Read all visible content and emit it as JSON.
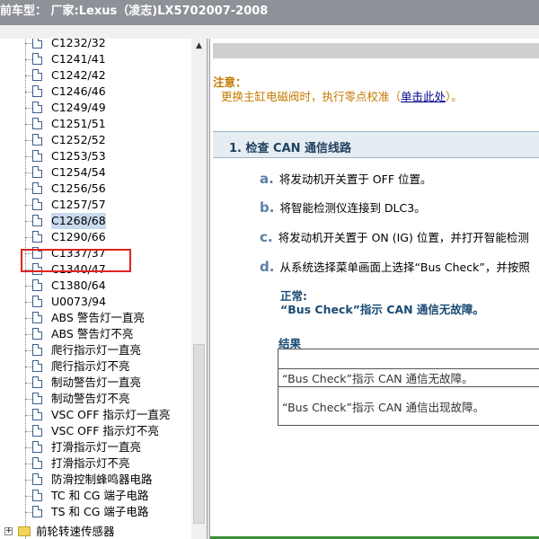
{
  "window": {
    "title": "前车型：  厂家:Lexus（凌志)LX5702007-2008"
  },
  "tree": {
    "items": [
      {
        "label": "C1232/32"
      },
      {
        "label": "C1241/41"
      },
      {
        "label": "C1242/42"
      },
      {
        "label": "C1246/46"
      },
      {
        "label": "C1249/49"
      },
      {
        "label": "C1251/51"
      },
      {
        "label": "C1252/52"
      },
      {
        "label": "C1253/53"
      },
      {
        "label": "C1254/54"
      },
      {
        "label": "C1256/56"
      },
      {
        "label": "C1257/57"
      },
      {
        "label": "C1268/68",
        "selected": true
      },
      {
        "label": "C1290/66"
      },
      {
        "label": "C1337/37"
      },
      {
        "label": "C1340/47"
      },
      {
        "label": "C1380/64"
      },
      {
        "label": "U0073/94"
      },
      {
        "label": "ABS 警告灯一直亮"
      },
      {
        "label": "ABS 警告灯不亮"
      },
      {
        "label": "爬行指示灯一直亮"
      },
      {
        "label": "爬行指示灯不亮"
      },
      {
        "label": "制动警告灯一直亮"
      },
      {
        "label": "制动警告灯不亮"
      },
      {
        "label": "VSC OFF 指示灯一直亮"
      },
      {
        "label": "VSC OFF 指示灯不亮"
      },
      {
        "label": "打滑指示灯一直亮"
      },
      {
        "label": "打滑指示灯不亮"
      },
      {
        "label": "防滑控制蜂鸣器电路"
      },
      {
        "label": "TC 和 CG 端子电路"
      },
      {
        "label": "TS 和 CG 端子电路"
      }
    ],
    "parent": {
      "label": "前轮转速传感器",
      "expand_symbol": "+"
    }
  },
  "scrollbar": {
    "up_arrow": "▲"
  },
  "content": {
    "note_title": "注意：",
    "note_text": "更换主缸电磁阀时，执行零点校准（",
    "note_link": "单击此处",
    "note_suffix": "）。",
    "step_title": "1. 检查 CAN 通信线路",
    "steps": [
      {
        "letter": "a.",
        "text": "将发动机开关置于 OFF 位置。"
      },
      {
        "letter": "b.",
        "text": "将智能检测仪连接到 DLC3。"
      },
      {
        "letter": "c.",
        "text": "将发动机开关置于 ON (IG) 位置，并打开智能检测"
      },
      {
        "letter": "d.",
        "text": "从系统选择菜单画面上选择“Bus Check”，并按照"
      }
    ],
    "normal_head": "正常:",
    "normal_body": "“Bus Check”指示 CAN 通信无故障。",
    "result_head": "结果",
    "result_rows": [
      {
        "text": ""
      },
      {
        "text": "“Bus Check”指示 CAN 通信无故障。"
      },
      {
        "text": "“Bus Check”指示 CAN 通信出现故障。"
      }
    ]
  },
  "colors": {
    "note": "#c47a00",
    "heading": "#1a4a74",
    "link": "#00008b",
    "highlight_box": "#e0231f"
  }
}
